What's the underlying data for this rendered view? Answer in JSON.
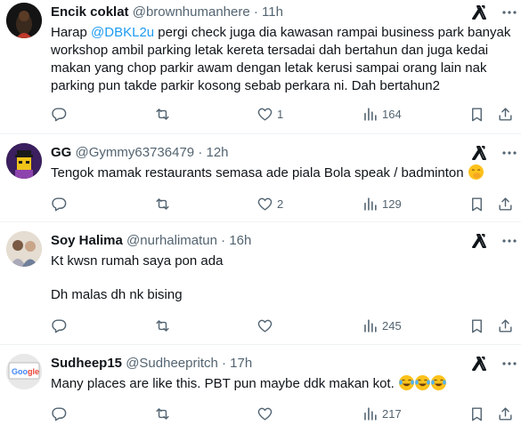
{
  "colors": {
    "accent": "#1d9bf0",
    "text": "#0f1419",
    "muted": "#536471",
    "divider": "#eff3f4"
  },
  "replies": [
    {
      "name": "Encik coklat",
      "handle": "@brownhumanhere",
      "time": "11h",
      "text_before": "Harap ",
      "mention": "@DBKL2u",
      "text_after": " pergi check juga dia kawasan rampai business park banyak workshop ambil parking letak kereta tersadai dah bertahun dan juga kedai makan yang chop parkir awam dengan letak kerusi sampai orang lain nak parking pun takde parkir kosong sebab perkara ni. Dah bertahun2",
      "replies": "",
      "reposts": "",
      "likes": "1",
      "views": "164"
    },
    {
      "name": "GG",
      "handle": "@Gymmy63736479",
      "time": "12h",
      "text": "Tengok mamak restaurants semasa ade piala Bola speak / badminton",
      "emoji": "face-with-hand-over-mouth",
      "replies": "",
      "reposts": "",
      "likes": "2",
      "views": "129"
    },
    {
      "name": "Soy Halima",
      "handle": "@nurhalimatun",
      "time": "16h",
      "line1": "Kt kwsn rumah saya pon ada",
      "line2": "Dh malas dh nk bising",
      "replies": "",
      "reposts": "",
      "likes": "",
      "views": "245"
    },
    {
      "name": "Sudheep15",
      "handle": "@Sudheepritch",
      "time": "17h",
      "text": "Many places are like this. PBT pun maybe ddk makan kot.",
      "emoji": "face-with-tears-of-joy x3",
      "replies": "",
      "reposts": "",
      "likes": "",
      "views": "217"
    }
  ],
  "icons": [
    "reply-icon",
    "repost-icon",
    "like-icon",
    "views-icon",
    "bookmark-icon",
    "share-icon",
    "grok-icon",
    "more-icon"
  ]
}
